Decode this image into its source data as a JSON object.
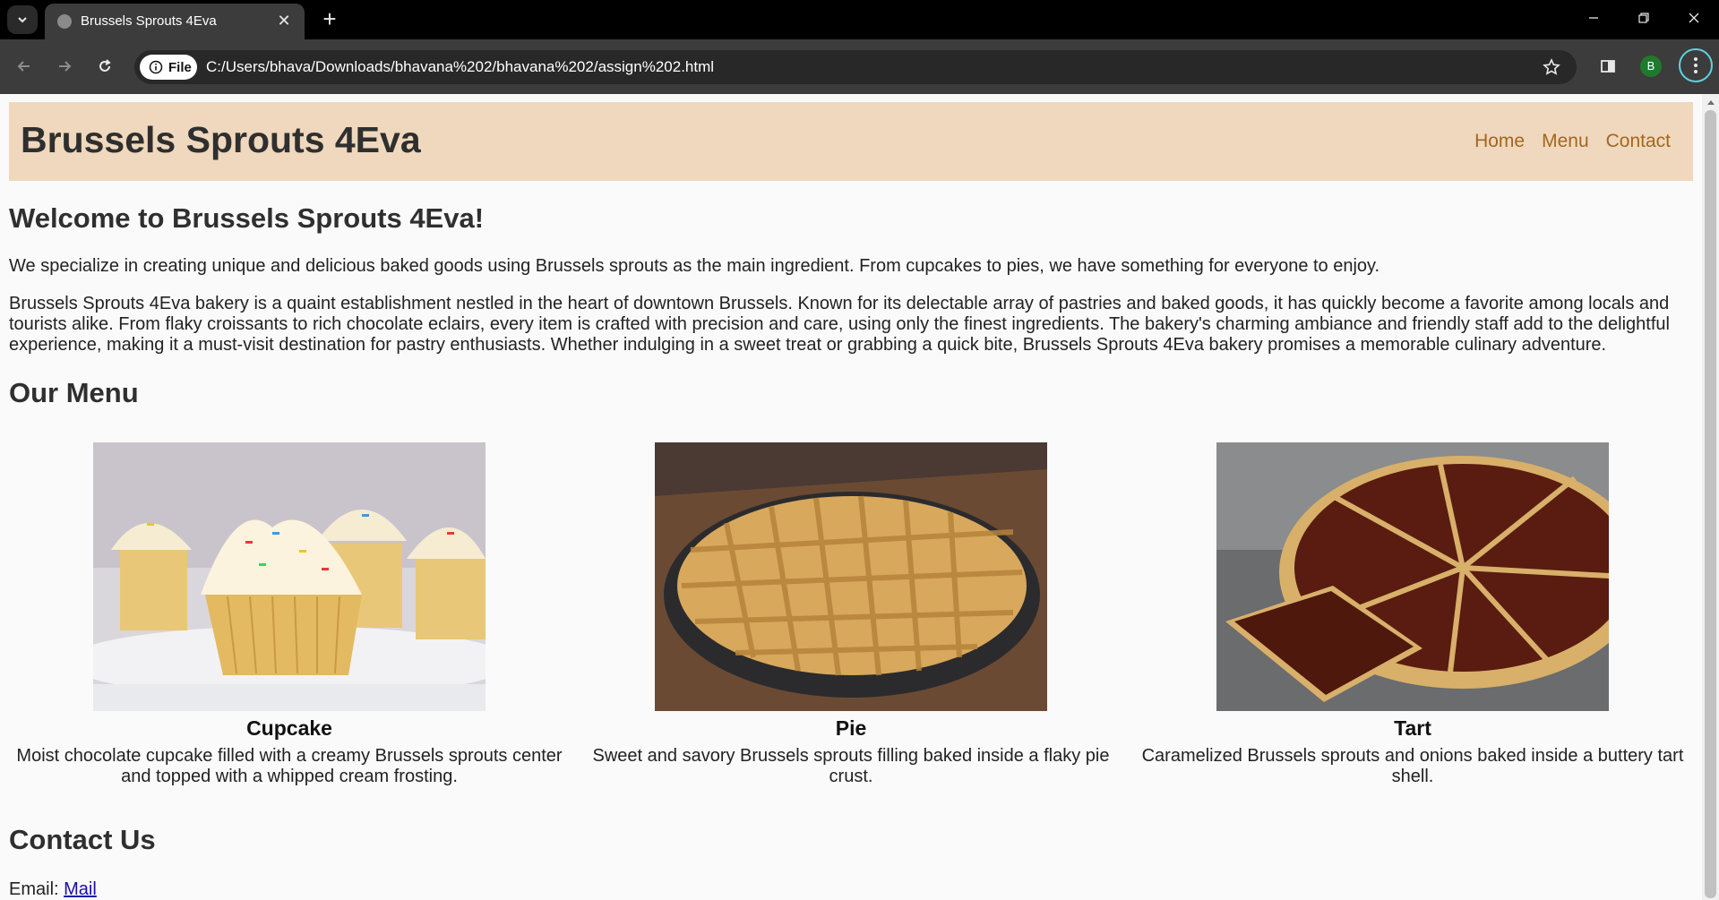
{
  "browser": {
    "tab_title": "Brussels Sprouts 4Eva",
    "close_glyph": "✕",
    "new_tab_glyph": "+",
    "site_chip": "File",
    "url": "C:/Users/bhava/Downloads/bhavana%202/bhavana%202/assign%202.html",
    "profile_initial": "B"
  },
  "site": {
    "title": "Brussels Sprouts 4Eva",
    "nav": [
      "Home",
      "Menu",
      "Contact"
    ]
  },
  "welcome": {
    "heading": "Welcome to Brussels Sprouts 4Eva!",
    "intro": "We specialize in creating unique and delicious baked goods using Brussels sprouts as the main ingredient. From cupcakes to pies, we have something for everyone to enjoy.",
    "about": "Brussels Sprouts 4Eva bakery is a quaint establishment nestled in the heart of downtown Brussels. Known for its delectable array of pastries and baked goods, it has quickly become a favorite among locals and tourists alike. From flaky croissants to rich chocolate eclairs, every item is crafted with precision and care, using only the finest ingredients. The bakery's charming ambiance and friendly staff add to the delightful experience, making it a must-visit destination for pastry enthusiasts. Whether indulging in a sweet treat or grabbing a quick bite, Brussels Sprouts 4Eva bakery promises a memorable culinary adventure."
  },
  "menu": {
    "heading": "Our Menu",
    "items": [
      {
        "name": "Cupcake",
        "description": "Moist chocolate cupcake filled with a creamy Brussels sprouts center and topped with a whipped cream frosting."
      },
      {
        "name": "Pie",
        "description": "Sweet and savory Brussels sprouts filling baked inside a flaky pie crust."
      },
      {
        "name": "Tart",
        "description": "Caramelized Brussels sprouts and onions baked inside a buttery tart shell."
      }
    ]
  },
  "contact": {
    "heading": "Contact Us",
    "email_label": "Email:",
    "email_link": "Mail"
  },
  "colors": {
    "header_bg": "#efd8bd",
    "nav_link": "#a4661f",
    "page_bg": "#fafafa"
  }
}
